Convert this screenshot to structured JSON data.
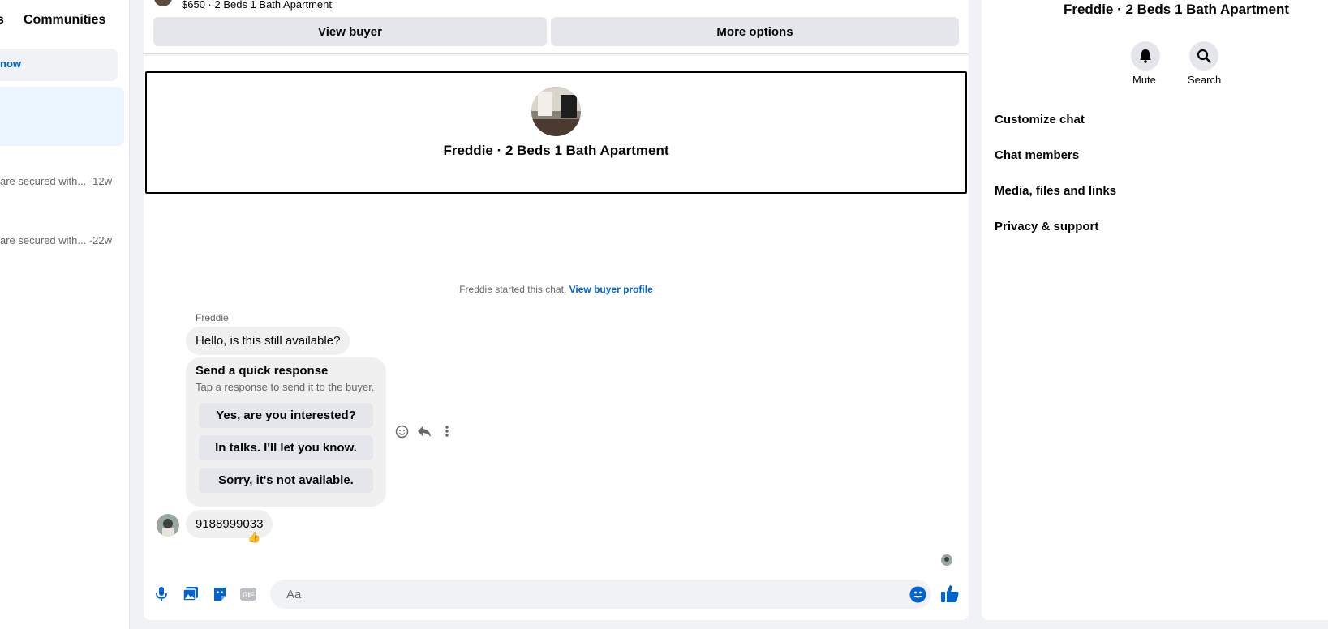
{
  "left": {
    "tab_partial": "s",
    "tab_communities": "Communities",
    "now_label": "now",
    "previews": [
      {
        "text": "are secured with... ·12w"
      },
      {
        "text": "are secured with... ·22w"
      }
    ]
  },
  "listing": {
    "title": "$650 · 2 Beds 1 Bath Apartment",
    "view_buyer": "View buyer",
    "more_options": "More options"
  },
  "profile": {
    "name": "Freddie · 2 Beds 1 Bath Apartment"
  },
  "chat": {
    "started_text": "Freddie started this chat.",
    "view_buyer_profile": "View buyer profile",
    "sender": "Freddie",
    "message1": "Hello, is this still available?",
    "quick_response": {
      "title": "Send a quick response",
      "subtitle": "Tap a response to send it to the buyer.",
      "options": [
        "Yes, are you interested?",
        "In talks. I'll let you know.",
        "Sorry, it's not available."
      ]
    },
    "message2": "9188999033",
    "reaction": "👍"
  },
  "composer": {
    "placeholder": "Aa",
    "gif_label": "GIF"
  },
  "right": {
    "title": "Freddie · 2 Beds 1 Bath Apartment",
    "mute": "Mute",
    "search": "Search",
    "items": [
      "Customize chat",
      "Chat members",
      "Media, files and links",
      "Privacy & support"
    ]
  },
  "colors": {
    "accent": "#0064d1",
    "bubble": "#f0f0f0",
    "button": "#e4e6eb"
  }
}
